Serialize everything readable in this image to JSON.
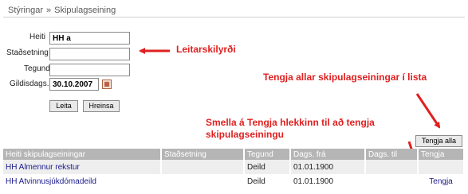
{
  "breadcrumb": {
    "root": "Stýringar",
    "separator": "»",
    "current": "Skipulagseining"
  },
  "form": {
    "heiti": {
      "label": "Heiti",
      "value": "HH a"
    },
    "stadsetning": {
      "label": "Staðsetning",
      "value": ""
    },
    "tegund": {
      "label": "Tegund",
      "value": ""
    },
    "gildisdags": {
      "label": "Gildisdags.",
      "value": "30.10.2007"
    },
    "buttons": {
      "search": "Leita",
      "clear": "Hreinsa"
    }
  },
  "connect_all_button": "Tengja alla",
  "annotations": {
    "search_criteria": "Leitarskilyrði",
    "connect_all": "Tengja allar skipulagseiningar í lista",
    "click_link_line1": "Smella á Tengja hlekkinn til að tengja",
    "click_link_line2": "skipulagseiningu",
    "color": "#e02020"
  },
  "table": {
    "headers": [
      "Heiti skipulagseiningar",
      "Staðsetning",
      "Tegund",
      "Dags. frá",
      "Dags. til",
      "Tengja"
    ],
    "rows": [
      {
        "heiti": "HH Almennur rekstur",
        "stadsetning": "",
        "tegund": "Deild",
        "dags_fra": "01.01.1900",
        "dags_til": "",
        "tengja": ""
      },
      {
        "heiti": "HH Atvinnusjúkdómadeild",
        "stadsetning": "",
        "tegund": "Deild",
        "dags_fra": "01.01.1900",
        "dags_til": "",
        "tengja": "Tengja"
      }
    ]
  }
}
